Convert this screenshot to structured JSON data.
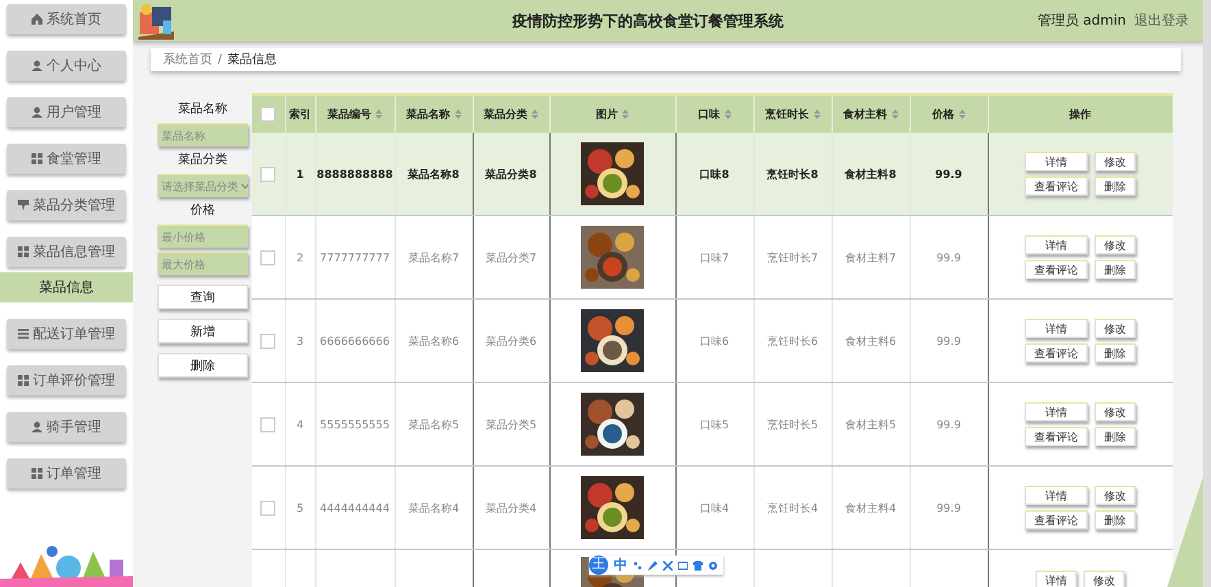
{
  "header": {
    "title": "疫情防控形势下的高校食堂订餐管理系统",
    "user": "管理员 admin",
    "logout": "退出登录"
  },
  "sidebar": {
    "items": [
      {
        "label": "系统首页",
        "selected": false
      },
      {
        "label": "个人中心",
        "selected": false
      },
      {
        "label": "用户管理",
        "selected": false
      },
      {
        "label": "食堂管理",
        "selected": false
      },
      {
        "label": "菜品分类管理",
        "selected": false
      },
      {
        "label": "菜品信息管理",
        "selected": false,
        "children": [
          {
            "label": "菜品信息",
            "selected": true
          }
        ]
      },
      {
        "label": "配送订单管理",
        "selected": false
      },
      {
        "label": "订单评价管理",
        "selected": false
      },
      {
        "label": "骑手管理",
        "selected": false
      },
      {
        "label": "订单管理",
        "selected": false
      }
    ]
  },
  "breadcrumb": {
    "items": [
      "系统首页",
      "菜品信息"
    ],
    "separator": "/"
  },
  "filters": [
    {
      "kind": "input",
      "label": "菜品名称",
      "placeholder": "菜品名称"
    },
    {
      "kind": "select",
      "label": "菜品分类",
      "placeholder": "请选择菜品分类"
    },
    {
      "kind": "range",
      "label": "价格",
      "placeholders": [
        "最小价格",
        "最大价格"
      ]
    }
  ],
  "filter_buttons": [
    "查询",
    "新增",
    "删除"
  ],
  "table": {
    "select_all": {
      "checked": false
    },
    "columns": [
      {
        "label": "索引",
        "sortable": false
      },
      {
        "label": "菜品编号",
        "sortable": true
      },
      {
        "label": "菜品名称",
        "sortable": true
      },
      {
        "label": "菜品分类",
        "sortable": true
      },
      {
        "label": "图片",
        "sortable": true
      },
      {
        "label": "口味",
        "sortable": true
      },
      {
        "label": "烹饪时长",
        "sortable": true
      },
      {
        "label": "食材主料",
        "sortable": true
      },
      {
        "label": "价格",
        "sortable": true
      },
      {
        "label": "操作",
        "sortable": false
      }
    ],
    "rows": [
      {
        "highlighted": true,
        "checked": false,
        "cells": [
          "1",
          "8888888888",
          "菜品名称8",
          "菜品分类8",
          {
            "kind": "picture"
          },
          "口味8",
          "烹饪时长8",
          "食材主料8",
          "99.9"
        ],
        "actions": [
          "详情",
          "修改",
          "查看评论",
          "删除"
        ]
      },
      {
        "highlighted": false,
        "checked": false,
        "cells": [
          "2",
          "7777777777",
          "菜品名称7",
          "菜品分类7",
          {
            "kind": "picture"
          },
          "口味7",
          "烹饪时长7",
          "食材主料7",
          "99.9"
        ],
        "actions": [
          "详情",
          "修改",
          "查看评论",
          "删除"
        ]
      },
      {
        "highlighted": false,
        "checked": false,
        "cells": [
          "3",
          "6666666666",
          "菜品名称6",
          "菜品分类6",
          {
            "kind": "picture"
          },
          "口味6",
          "烹饪时长6",
          "食材主料6",
          "99.9"
        ],
        "actions": [
          "详情",
          "修改",
          "查看评论",
          "删除"
        ]
      },
      {
        "highlighted": false,
        "checked": false,
        "cells": [
          "4",
          "5555555555",
          "菜品名称5",
          "菜品分类5",
          {
            "kind": "picture"
          },
          "口味5",
          "烹饪时长5",
          "食材主料5",
          "99.9"
        ],
        "actions": [
          "详情",
          "修改",
          "查看评论",
          "删除"
        ]
      },
      {
        "highlighted": false,
        "checked": false,
        "cells": [
          "5",
          "4444444444",
          "菜品名称4",
          "菜品分类4",
          {
            "kind": "picture"
          },
          "口味4",
          "烹饪时长4",
          "食材主料4",
          "99.9"
        ],
        "actions": [
          "详情",
          "修改",
          "查看评论",
          "删除"
        ]
      },
      {
        "highlighted": false,
        "partial": true,
        "cells": [
          null,
          null,
          null,
          null,
          {
            "kind": "picture"
          }
        ],
        "actions": [
          "详情",
          "修改"
        ]
      }
    ]
  },
  "ime_toolbar": {
    "badge": "王",
    "mode": "中"
  }
}
